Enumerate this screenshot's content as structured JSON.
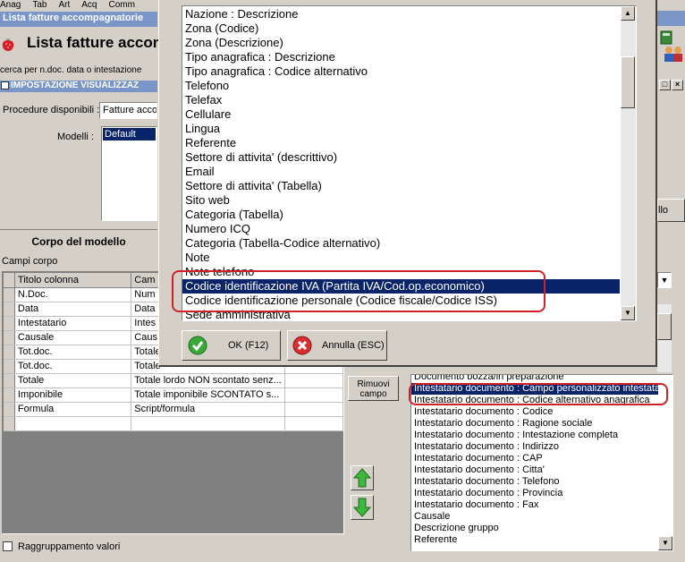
{
  "menu": [
    "Anag",
    "Tab",
    "Art",
    "Acq",
    "Comm"
  ],
  "window_title": "Lista fatture accompagnatorie",
  "header_title": "Lista fatture accom",
  "search_label": "cerca per n.doc. data o intestazione",
  "settings_header": "IMPOSTAZIONE VISUALIZZAZ",
  "procedure": {
    "label": "Procedure disponibili :",
    "value": "Fatture acco"
  },
  "models": {
    "label": "Modelli :",
    "items": [
      "Default"
    ]
  },
  "body_section": {
    "title": "Corpo del modello",
    "fields_label": "Campi corpo"
  },
  "grid": {
    "headers": [
      "Titolo colonna",
      "Cam"
    ],
    "rows": [
      [
        "N.Doc.",
        "Num"
      ],
      [
        "Data",
        "Data"
      ],
      [
        "Intestatario",
        "Intes"
      ],
      [
        "Causale",
        "Caus"
      ],
      [
        "Tot.doc.",
        "Totale"
      ],
      [
        "Tot.doc.",
        "Totale"
      ],
      [
        "Totale",
        "Totale lordo NON scontato senz..."
      ],
      [
        "Imponibile",
        "Totale imponibile SCONTATO s..."
      ],
      [
        "Formula",
        "Script/formula"
      ]
    ]
  },
  "group_values_label": "Raggruppamento valori",
  "remove_button": "Rimuovi campo",
  "right_button_fragment": "llo",
  "right_list": [
    "Documento bozza/in preparazione",
    "Intestatario documento : Campo personalizzato intestatario",
    "Intestatario documento : Codice alternativo anagrafica",
    "Intestatario documento : Codice",
    "Intestatario documento : Ragione sociale",
    "Intestatario documento : Intestazione completa",
    "Intestatario documento : Indirizzo",
    "Intestatario documento : CAP",
    "Intestatario documento : Citta'",
    "Intestatario documento : Telefono",
    "Intestatario documento : Provincia",
    "Intestatario documento : Fax",
    "Causale",
    "Descrizione gruppo",
    "Referente"
  ],
  "popup_list": [
    "Nazione : Descrizione",
    "Zona (Codice)",
    "Zona (Descrizione)",
    "Tipo anagrafica : Descrizione",
    "Tipo anagrafica : Codice alternativo",
    "Telefono",
    "Telefax",
    "Cellulare",
    "Lingua",
    "Referente",
    "Settore di attivita' (descrittivo)",
    "Email",
    "Settore di attivita' (Tabella)",
    "Sito web",
    "Categoria (Tabella)",
    "Numero ICQ",
    "Categoria (Tabella-Codice alternativo)",
    "Note",
    "Note telefono",
    "Codice identificazione IVA (Partita IVA/Cod.op.economico)",
    "Codice identificazione personale (Codice fiscale/Codice ISS)",
    "Sede amministrativa"
  ],
  "ok_button": "OK (F12)",
  "cancel_button": "Annulla (ESC)",
  "colors": {
    "selection": "#0a246a",
    "title_bar": "#7a96c8",
    "highlight_box": "#d0202a"
  }
}
